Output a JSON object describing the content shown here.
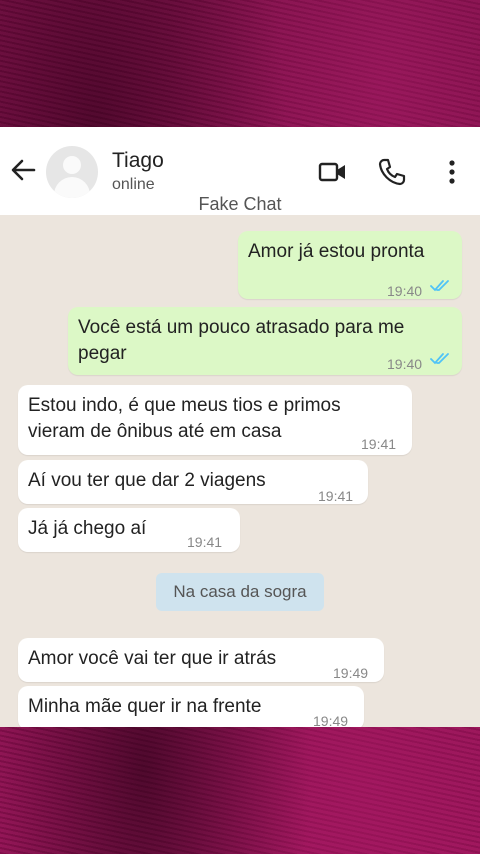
{
  "header": {
    "contact_name": "Tiago",
    "contact_status": "online",
    "subtitle": "Fake Chat",
    "icons": [
      "back-arrow-icon",
      "avatar-placeholder",
      "video-call-icon",
      "voice-call-icon",
      "more-options-icon"
    ]
  },
  "colors": {
    "outgoing_bubble": "#dcf8c6",
    "incoming_bubble": "#ffffff",
    "chat_background": "#ece5dd",
    "read_ticks": "#4fc3f7",
    "outer_background": "#8a0f4e"
  },
  "messages": [
    {
      "text": "Amor já estou pronta",
      "time": "19:40",
      "direction": "outgoing"
    },
    {
      "text_line1": "Você está  um pouco atrasado para me",
      "text_line2": "pegar",
      "time": "19:40",
      "direction": "outgoing"
    },
    {
      "text_line1": "Estou indo, é que meus tios e primos",
      "text_line2": "vieram de ônibus até em casa",
      "time": "19:41",
      "direction": "incoming"
    },
    {
      "text": "Aí vou ter que dar 2 viagens",
      "time": "19:41",
      "direction": "incoming"
    },
    {
      "text": "Já já chego aí",
      "time": "19:41",
      "direction": "incoming"
    },
    {
      "text": "Amor você vai ter que ir atrás",
      "time": "19:49",
      "direction": "incoming"
    },
    {
      "text": "Minha mãe quer ir na frente",
      "time": "19:49",
      "direction": "incoming"
    }
  ],
  "banner": {
    "text": "Na casa da sogra"
  }
}
